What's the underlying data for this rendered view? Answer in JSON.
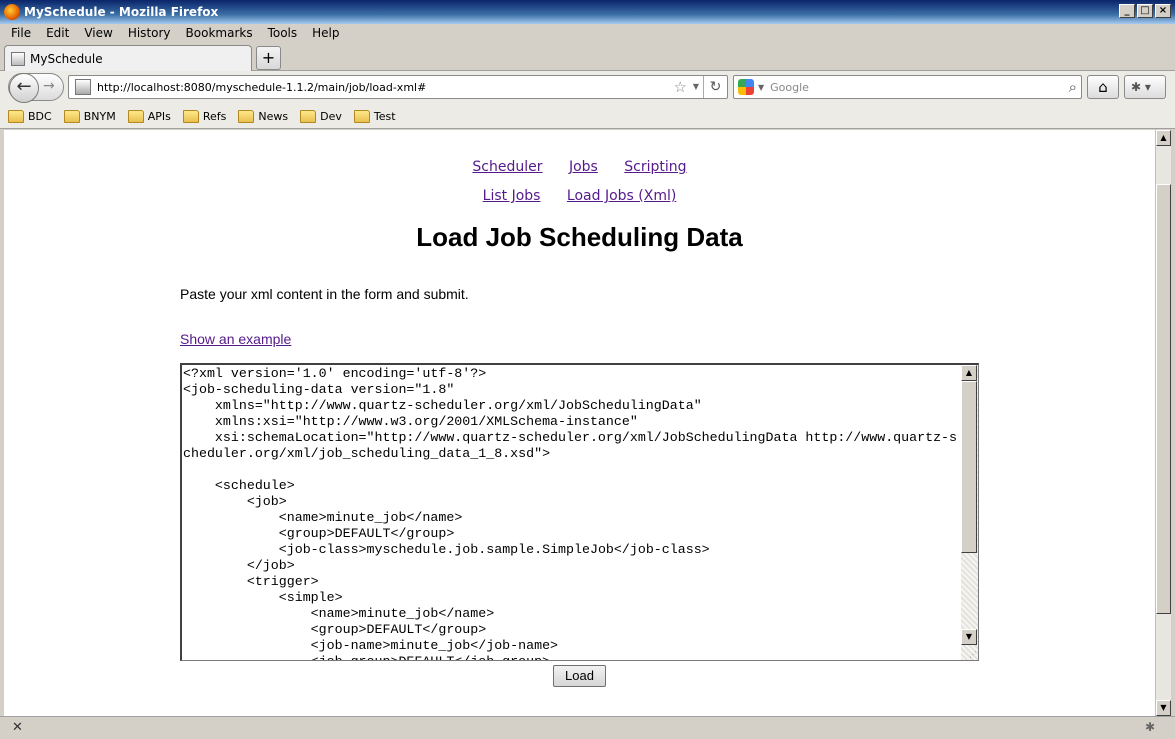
{
  "window": {
    "title": "MySchedule - Mozilla Firefox"
  },
  "menu": [
    "File",
    "Edit",
    "View",
    "History",
    "Bookmarks",
    "Tools",
    "Help"
  ],
  "tab": {
    "title": "MySchedule"
  },
  "url": "http://localhost:8080/myschedule-1.1.2/main/job/load-xml#",
  "search": {
    "placeholder": "Google"
  },
  "bookmarks": [
    "BDC",
    "BNYM",
    "APIs",
    "Refs",
    "News",
    "Dev",
    "Test"
  ],
  "nav": {
    "primary": [
      "Scheduler",
      "Jobs",
      "Scripting"
    ],
    "secondary": [
      "List Jobs",
      "Load Jobs (Xml)"
    ]
  },
  "page": {
    "title": "Load Job Scheduling Data",
    "instruction": "Paste your xml content in the form and submit.",
    "example_link": "Show an example",
    "xml": "<?xml version='1.0' encoding='utf-8'?>\n<job-scheduling-data version=\"1.8\"\n    xmlns=\"http://www.quartz-scheduler.org/xml/JobSchedulingData\"\n    xmlns:xsi=\"http://www.w3.org/2001/XMLSchema-instance\"\n    xsi:schemaLocation=\"http://www.quartz-scheduler.org/xml/JobSchedulingData http://www.quartz-scheduler.org/xml/job_scheduling_data_1_8.xsd\">\n\n    <schedule>\n        <job>\n            <name>minute_job</name>\n            <group>DEFAULT</group>\n            <job-class>myschedule.job.sample.SimpleJob</job-class>\n        </job>\n        <trigger>\n            <simple>\n                <name>minute_job</name>\n                <group>DEFAULT</group>\n                <job-name>minute_job</job-name>\n                <job-group>DEFAULT</job-group>",
    "load_button": "Load"
  }
}
